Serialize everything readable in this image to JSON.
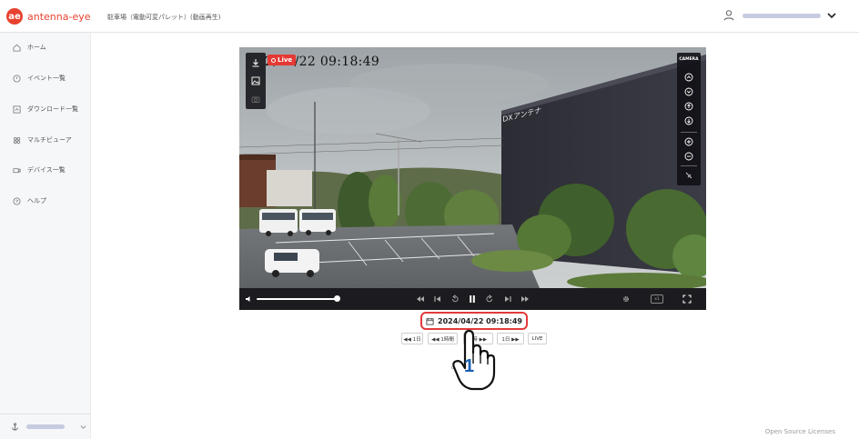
{
  "app": {
    "logo_mark": "ae",
    "logo_text": "antenna-eye",
    "breadcrumb": "駐車場（電動可変パレット）(動画再生)"
  },
  "header": {
    "user_icon": "user-icon",
    "user_email": "",
    "chevron": "chevron-down-icon"
  },
  "sidebar": {
    "items": [
      {
        "label": "ホーム",
        "icon": "home-icon"
      },
      {
        "label": "イベント一覧",
        "icon": "event-icon"
      },
      {
        "label": "ダウンロード一覧",
        "icon": "download-list-icon"
      },
      {
        "label": "マルチビューア",
        "icon": "multiview-icon"
      },
      {
        "label": "デバイス一覧",
        "icon": "device-icon"
      },
      {
        "label": "ヘルプ",
        "icon": "help-icon"
      }
    ],
    "footer": {
      "icon": "anchor-icon",
      "chevron": "chevron-down-icon"
    }
  },
  "player": {
    "live_label": "Live",
    "osd_timestamp": "2/01/22 09:18:49",
    "signage_text": "DXアンテナ",
    "camera_panel_title": "CAMERA",
    "left_tools": [
      "download-icon",
      "image-icon",
      "camera-icon"
    ],
    "camera_controls": [
      "pan-up-icon",
      "pan-down-icon",
      "tilt-up-icon",
      "tilt-down-icon",
      "zoom-in-icon",
      "zoom-out-icon",
      "ptz-off-icon"
    ],
    "controls": {
      "volume_level": 0.95,
      "quality_label": "x1"
    }
  },
  "date_selector": {
    "datetime": "2024/04/22 09:18:49",
    "buttons": [
      "◀◀ 1日",
      "◀◀ 1時間",
      "1時 ▶▶",
      "1日 ▶▶",
      "LIVE"
    ],
    "partial_label": "cl"
  },
  "annotation": {
    "step": "1"
  },
  "footer": {
    "licenses": "Open Source Licenses"
  },
  "colors": {
    "brand": "#e8412f",
    "highlight": "#e23a3a",
    "step_number": "#1a5fb4"
  }
}
